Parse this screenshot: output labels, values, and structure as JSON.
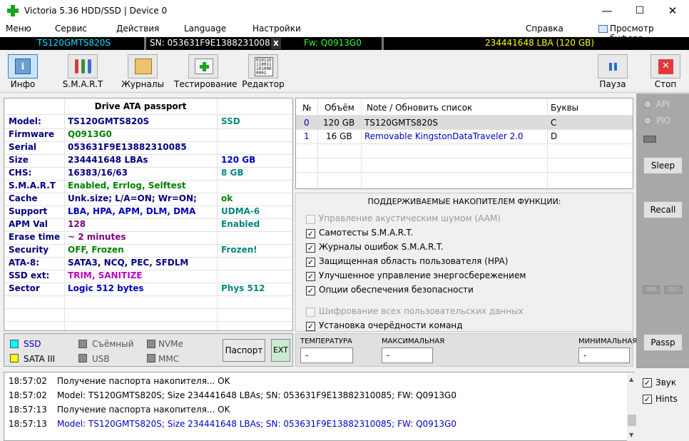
{
  "window": {
    "title": "Victoria 5.36 HDD/SSD | Device 0",
    "minimize": "—",
    "maximize": "☐",
    "close": "✕"
  },
  "menu": {
    "items": [
      "Меню",
      "Сервис",
      "Действия",
      "Language",
      "Настройки",
      "Справка"
    ],
    "buffer_viewer": "Просмотр буфера"
  },
  "device_strip": {
    "model": "TS120GMTS820S",
    "serial": "SN: 053631F9E13882310085",
    "close": "x",
    "firmware": "Fw: Q0913G0",
    "lba": "234441648 LBA (120 GB)"
  },
  "toolbar": {
    "info": "Инфо",
    "smart": "S.M.A.R.T",
    "logs": "Журналы",
    "testing": "Тестирование",
    "editor": "Редактор",
    "pause": "Пауза",
    "stop": "Стоп",
    "editor_icon_text": "010110\n110011\n101000\n0001"
  },
  "passport": {
    "header": "Drive ATA passport",
    "rows": [
      {
        "key": "Model:",
        "value": "TS120GMTS820S",
        "extra": "SSD",
        "vcolor": "#000080",
        "ecolor": "#00897b"
      },
      {
        "key": "Firmware",
        "value": "Q0913G0",
        "extra": "",
        "vcolor": "#008000",
        "ecolor": "#000080"
      },
      {
        "key": "Serial",
        "value": "053631F9E13882310085",
        "extra": "",
        "vcolor": "#000080",
        "ecolor": "#000080"
      },
      {
        "key": "Size",
        "value": "234441648 LBAs",
        "extra": "120 GB",
        "vcolor": "#000080",
        "ecolor": "#0000c0"
      },
      {
        "key": "CHS:",
        "value": "16383/16/63",
        "extra": "8 GB",
        "vcolor": "#000080",
        "ecolor": "#00897b"
      },
      {
        "key": "S.M.A.R.T",
        "value": "Enabled, Errlog, Selftest",
        "extra": "",
        "vcolor": "#008000",
        "ecolor": "#000080"
      },
      {
        "key": "Cache",
        "value": "Unk.size; L/A=ON; Wr=ON;",
        "extra": "ok",
        "vcolor": "#000080",
        "ecolor": "#008000"
      },
      {
        "key": "Support",
        "value": "LBA, HPA, APM, DLM, DMA",
        "extra": "UDMA-6",
        "vcolor": "#0000c0",
        "ecolor": "#00897b"
      },
      {
        "key": "APM Val",
        "value": "128",
        "extra": "Enabled",
        "vcolor": "#800080",
        "ecolor": "#00897b"
      },
      {
        "key": "Erase time",
        "value": "~ 2 minutes",
        "extra": "",
        "vcolor": "#800080",
        "ecolor": "#000080"
      },
      {
        "key": "Security",
        "value": "OFF, Frozen",
        "extra": "Frozen!",
        "vcolor": "#008000",
        "ecolor": "#00897b"
      },
      {
        "key": "ATA-8:",
        "value": "SATA3, NCQ, PEC, SFDLM",
        "extra": "",
        "vcolor": "#000080",
        "ecolor": "#000080"
      },
      {
        "key": "SSD ext:",
        "value": "TRIM, SANITIZE",
        "extra": "",
        "vcolor": "#c000c0",
        "ecolor": "#000080"
      },
      {
        "key": "Sector",
        "value": "Logic 512 bytes",
        "extra": "Phys 512",
        "vcolor": "#0000c0",
        "ecolor": "#00897b"
      }
    ]
  },
  "legend": {
    "ssd": "SSD",
    "sata3": "SATA III",
    "removable": "Съёмный",
    "usb": "USB",
    "nvme": "NVMe",
    "mmc": "MMC",
    "passport_btn": "Паспорт",
    "ext_btn": "EXT",
    "ssd_color": "#00ffff",
    "sata_color": "#ffff00",
    "gray_color": "#8c8c8c"
  },
  "devices": {
    "headers": [
      "№",
      "Объём",
      "Note / Обновить список",
      "Буквы"
    ],
    "rows": [
      {
        "num": "0",
        "size": "120 GB",
        "note": "TS120GMTS820S",
        "letter": "C"
      },
      {
        "num": "1",
        "size": "16 GB",
        "note": "Removable KingstonDataTraveler 2.0",
        "letter": "D"
      }
    ]
  },
  "features": {
    "title": "ПОДДЕРЖИВАЕМЫЕ НАКОПИТЕЛЕМ ФУНКЦИИ:",
    "items": [
      {
        "label": "Управление акустическим шумом (AAM)",
        "checked": false,
        "enabled": false
      },
      {
        "label": "Самотесты S.M.A.R.T.",
        "checked": true,
        "enabled": true
      },
      {
        "label": "Журналы ошибок S.M.A.R.T.",
        "checked": true,
        "enabled": true
      },
      {
        "label": "Защищенная область пользователя (HPA)",
        "checked": true,
        "enabled": true
      },
      {
        "label": "Улучшенное управление энергосбережением",
        "checked": true,
        "enabled": true
      },
      {
        "label": "Опции обеспечения безопасности",
        "checked": true,
        "enabled": true
      },
      {
        "label": "Шифрование всех пользовательских данных",
        "checked": false,
        "enabled": false
      },
      {
        "label": "Установка очерёдности команд",
        "checked": true,
        "enabled": true
      }
    ]
  },
  "temps": {
    "temperature": "ТЕМПЕРАТУРА",
    "max": "МАКСИМАЛЬНАЯ",
    "min": "МИНИМАЛЬНАЯ",
    "value": "-"
  },
  "rightpanel": {
    "api": "API",
    "pio": "PIO",
    "sleep": "Sleep",
    "recall": "Recall",
    "wr": "WR",
    "rd": "RD",
    "passp": "Passp"
  },
  "log": {
    "lines": [
      {
        "time": "18:57:02",
        "text": "Получение паспорта накопителя... OK",
        "color": "#000000"
      },
      {
        "time": "18:57:02",
        "text": "Model: TS120GMTS820S; Size 234441648 LBAs; SN: 053631F9E13882310085; FW: Q0913G0",
        "color": "#000000"
      },
      {
        "time": "18:57:13",
        "text": "Получение паспорта накопителя... OK",
        "color": "#000000"
      },
      {
        "time": "18:57:13",
        "text": "Model: TS120GMTS820S; Size 234441648 LBAs; SN: 053631F9E13882310085; FW: Q0913G0",
        "color": "#0000c0"
      }
    ]
  },
  "options": {
    "sound": "Звук",
    "hints": "Hints"
  }
}
